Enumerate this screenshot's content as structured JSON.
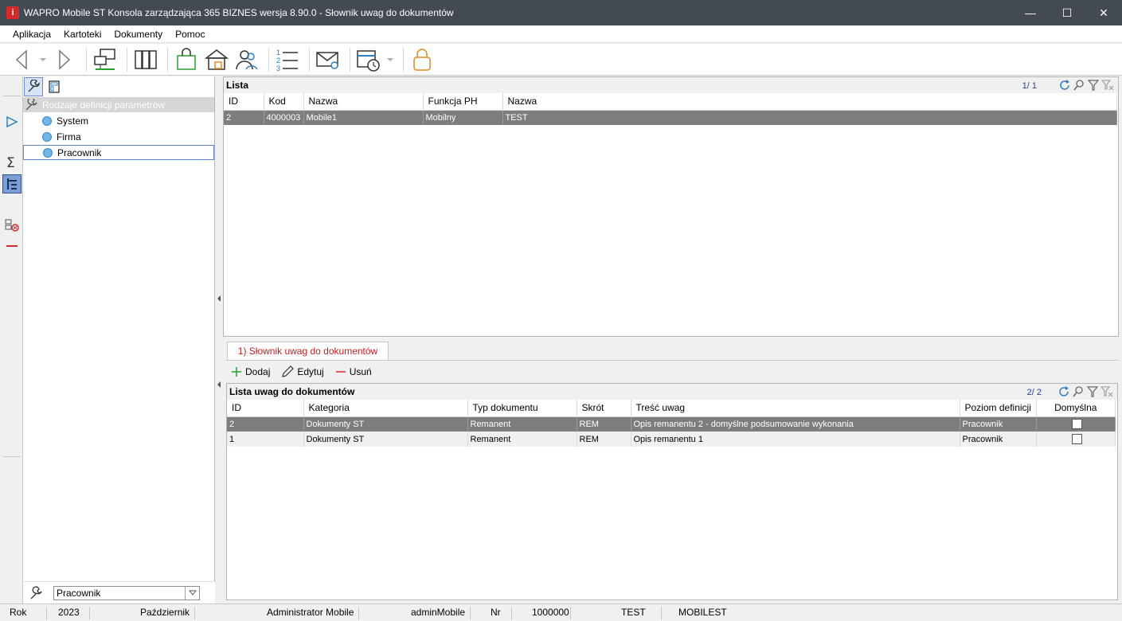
{
  "window": {
    "app_icon_glyph": "i",
    "title": "WAPRO Mobile ST Konsola zarządzająca 365 BIZNES wersja 8.90.0 - Słownik uwag do dokumentów",
    "minimize": "—",
    "maximize": "☐",
    "close": "✕"
  },
  "menu": [
    "Aplikacja",
    "Kartoteki",
    "Dokumenty",
    "Pomoc"
  ],
  "left_panel": {
    "root_label": "Rodzaje definicji parametrów",
    "items": [
      "System",
      "Firma",
      "Pracownik"
    ],
    "selected": "Pracownik",
    "combo_value": "Pracownik"
  },
  "upper_list": {
    "title": "Lista",
    "counter": "1/ 1",
    "columns": [
      "ID",
      "Kod",
      "Nazwa",
      "Funkcja PH",
      "Nazwa"
    ],
    "rows": [
      [
        "2",
        "4000003",
        "Mobile1",
        "Mobilny",
        "TEST"
      ]
    ]
  },
  "subtab": {
    "label": "1) Słownik uwag do dokumentów"
  },
  "actions": {
    "add": "Dodaj",
    "edit": "Edytuj",
    "delete": "Usuń"
  },
  "lower_list": {
    "title": "Lista uwag do dokumentów",
    "counter": "2/ 2",
    "columns": [
      "ID",
      "Kategoria",
      "Typ dokumentu",
      "Skrót",
      "Treść uwag",
      "Poziom definicji",
      "Domyślna"
    ],
    "rows": [
      [
        "2",
        "Dokumenty ST",
        "Remanent",
        "REM",
        "Opis remanentu 2 - domyślne podsumowanie wykonania",
        "Pracownik",
        true
      ],
      [
        "1",
        "Dokumenty ST",
        "Remanent",
        "REM",
        "Opis remanentu 1",
        "Pracownik",
        false
      ]
    ]
  },
  "status": {
    "rok_label": "Rok",
    "rok": "2023",
    "month": "Październik",
    "user": "Administrator Mobile",
    "login": "adminMobile",
    "nr_label": "Nr",
    "nr": "1000000",
    "env": "TEST",
    "db": "MOBILEST"
  },
  "colors": {
    "accent": "#2f7fc1",
    "selection": "#7d7d7d",
    "titlebar": "#434a54",
    "subtab_text": "#c02020"
  }
}
